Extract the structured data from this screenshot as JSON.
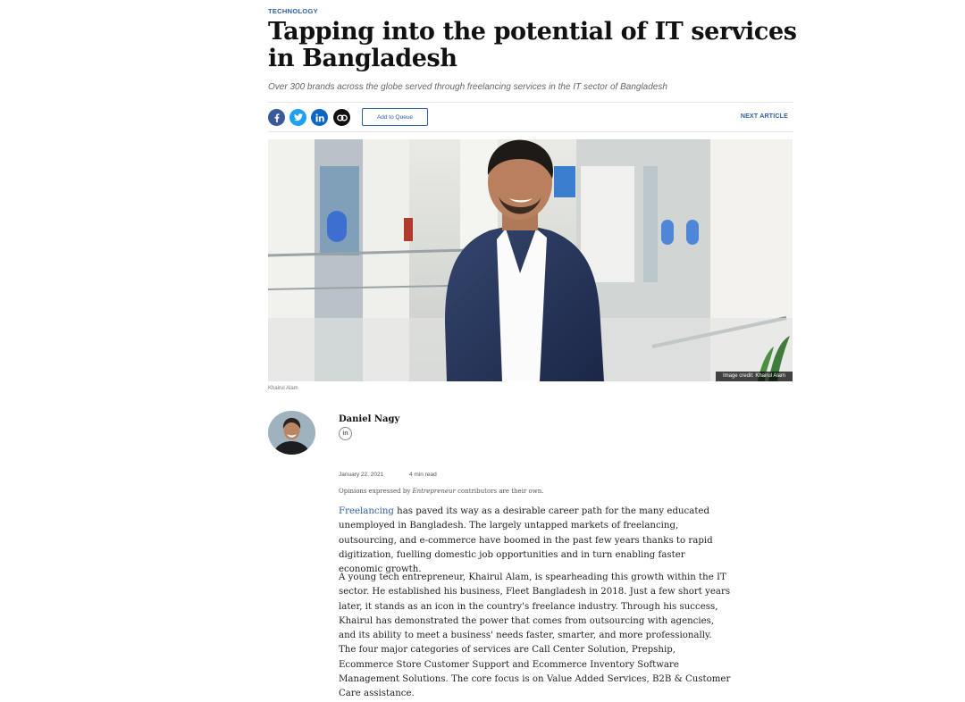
{
  "article": {
    "category": "TECHNOLOGY",
    "title": "Tapping into the potential of IT services in Bangladesh",
    "subtitle": "Over 300 brands across the globe served through freelancing services in the IT sector of Bangladesh"
  },
  "share_bar": {
    "icons": [
      "facebook-icon",
      "twitter-icon",
      "linkedin-icon",
      "link-icon"
    ],
    "queue_label": "Add to Queue",
    "next_label": "NEXT ARTICLE"
  },
  "hero": {
    "credit": "Image credit: Khairul Alam",
    "caption": "Khairul Alam"
  },
  "author": {
    "name": "Daniel Nagy",
    "social_icon": "linkedin-icon"
  },
  "meta": {
    "date": "January 22, 2021",
    "read_time": "4 min read",
    "opinion_before": "Opinions expressed by ",
    "opinion_brand": "Entrepreneur",
    "opinion_after": " contributors are their own."
  },
  "body": {
    "p1_link": "Freelancing",
    "p1_rest": " has paved its way as a desirable career path for the many educated unemployed in Bangladesh. The largely untapped markets of freelancing, outsourcing, and e-commerce have boomed in the past few years thanks to rapid digitization, fuelling domestic job opportunities and in turn enabling faster economic growth.",
    "p2": "A young tech entrepreneur, Khairul Alam, is spearheading this growth within the IT sector. He established his business, Fleet Bangladesh in 2018. Just a few short years later, it stands as an icon in the country's freelance industry. Through his success, Khairul has demonstrated the power that comes from outsourcing with agencies, and its ability to meet a business' needs faster, smarter, and more professionally. The four major categories of services are Call Center Solution, Prepship, Ecommerce Store Customer Support and Ecommerce Inventory Software Management Solutions. The core focus is on Value Added Services, B2B & Customer Care assistance."
  },
  "colors": {
    "accent": "#2f5fa5",
    "facebook": "#3b5998",
    "twitter": "#1da1f2",
    "linkedin": "#0a66c2"
  }
}
